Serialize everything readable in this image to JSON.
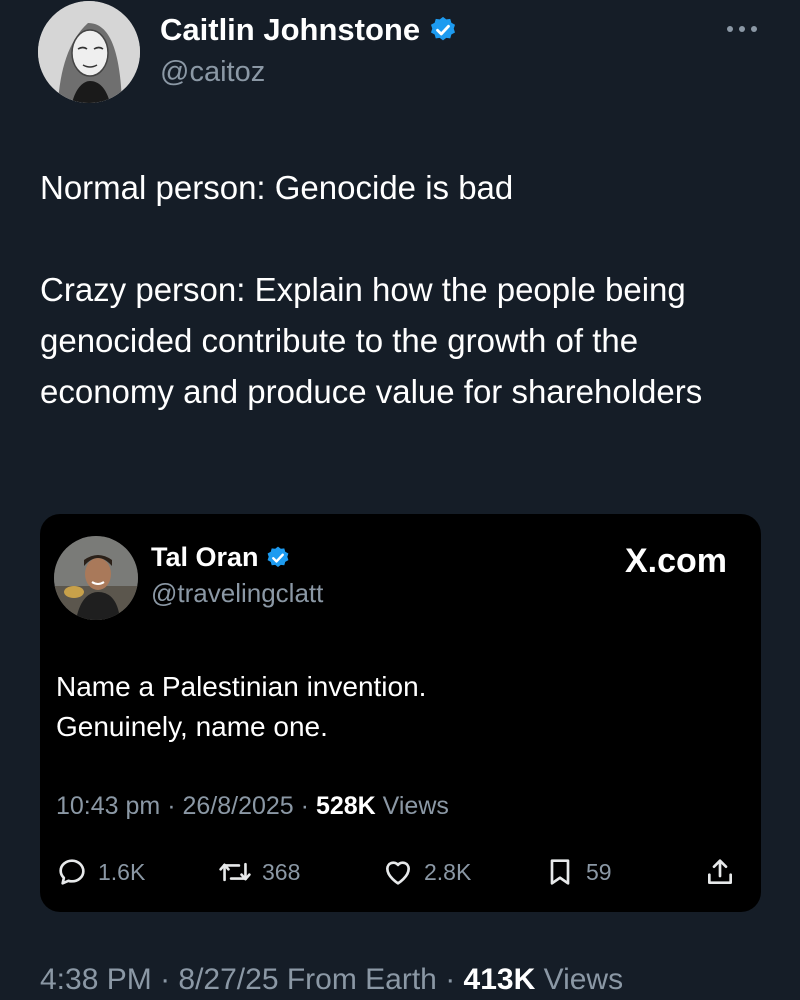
{
  "author": {
    "name": "Caitlin Johnstone",
    "handle": "@caitoz",
    "verified": true,
    "avatar_icon": "sketch-portrait-avatar"
  },
  "post": {
    "line1": "Normal person: Genocide is bad",
    "line2": "Crazy person: Explain how the people being genocided contribute to the growth of the economy and produce value for shareholders"
  },
  "quoted": {
    "name": "Tal Oran",
    "handle": "@travelingclatt",
    "verified": true,
    "site": "X.com",
    "text_line1": "Name a Palestinian invention.",
    "text_line2": "Genuinely, name one.",
    "meta": {
      "time": "10:43 pm",
      "date": "26/8/2025",
      "views_count": "528K",
      "views_label": "Views"
    },
    "actions": {
      "replies": "1.6K",
      "reposts": "368",
      "likes": "2.8K",
      "bookmarks": "59"
    }
  },
  "footer": {
    "time": "4:38 PM",
    "date_place": "8/27/25 From Earth",
    "views_count": "413K",
    "views_label": "Views"
  },
  "colors": {
    "background": "#151d27",
    "card_background": "#000000",
    "text_primary": "#ffffff",
    "text_secondary": "#8b98a5",
    "verified_blue": "#1d9bf0"
  }
}
